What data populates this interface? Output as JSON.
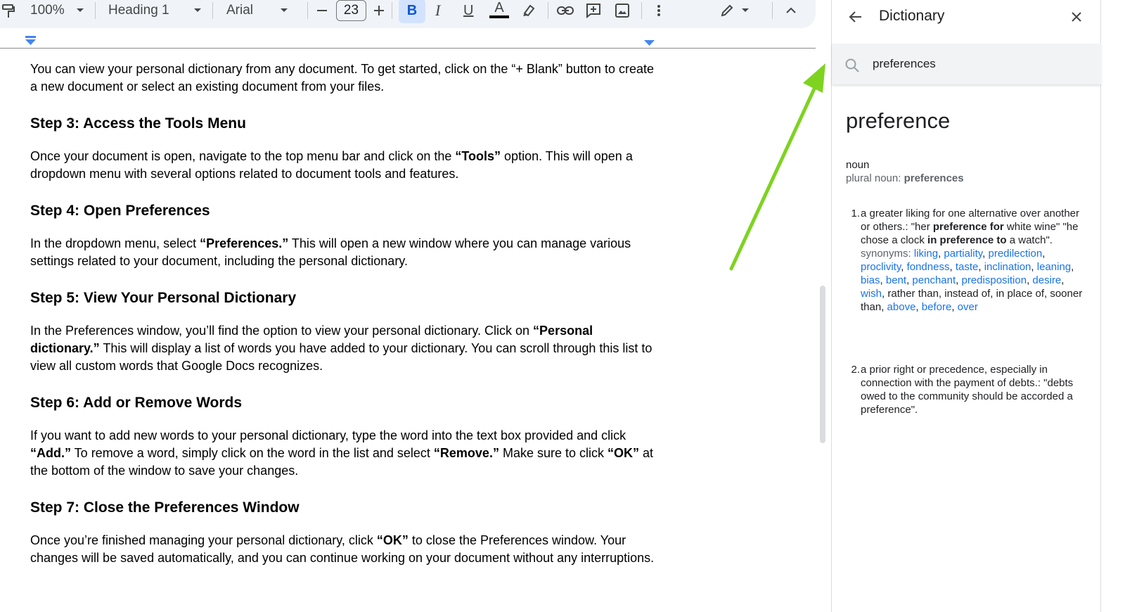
{
  "toolbar": {
    "zoom": "100%",
    "style": "Heading 1",
    "font": "Arial",
    "font_size": "23",
    "bold_label": "B",
    "italic_label": "I",
    "underline_label": "U",
    "text_color_label": "A"
  },
  "document": {
    "intro": "You can view your personal dictionary from any document. To get started, click on the “+ Blank” button to create a new document or select an existing document from your files.",
    "step3_heading": "Step 3: Access the Tools Menu",
    "step3_pre": "Once your document is open, navigate to the top menu bar and click on the ",
    "step3_bold": "“Tools”",
    "step3_post": " option. This will open a dropdown menu with several options related to document tools and features.",
    "step4_heading": "Step 4: Open Preferences",
    "step4_pre": "In the dropdown menu, select ",
    "step4_bold": "“Preferences.”",
    "step4_post": " This will open a new window where you can manage various settings related to your document, including the personal dictionary.",
    "step5_heading": "Step 5: View Your Personal Dictionary",
    "step5_pre": "In the Preferences window, you’ll find the option to view your personal dictionary. Click on ",
    "step5_bold": "“Personal dictionary.”",
    "step5_post": " This will display a list of words you have added to your dictionary. You can scroll through this list to view all custom words that Google Docs recognizes.",
    "step6_heading": "Step 6: Add or Remove Words",
    "step6_a": "If you want to add new words to your personal dictionary, type the word into the text box provided and click ",
    "step6_b": "“Add.”",
    "step6_c": " To remove a word, simply click on the word in the list and select ",
    "step6_d": "“Remove.”",
    "step6_e": " Make sure to click ",
    "step6_f": "“OK”",
    "step6_g": " at the bottom of the window to save your changes.",
    "step7_heading": "Step 7: Close the Preferences Window",
    "step7_pre": "Once you’re finished managing your personal dictionary, click ",
    "step7_bold": "“OK”",
    "step7_post": " to close the Preferences window. Your changes will be saved automatically, and you can continue working on your document without any interruptions."
  },
  "dictionary": {
    "title": "Dictionary",
    "search_value": "preferences",
    "word": "preference",
    "part_of_speech": "noun",
    "plural_label": "plural noun: ",
    "plural_value": "preferences",
    "def1_num": "1.",
    "def1_a": "a greater liking for one alternative over another or others.: \"her ",
    "def1_b": "preference for",
    "def1_c": " white wine\" \"he chose a clock ",
    "def1_d": "in preference to",
    "def1_e": " a watch\".",
    "synonyms_label": "synonyms: ",
    "synonyms": [
      "liking",
      "partiality",
      "predilection",
      "proclivity",
      "fondness",
      "taste",
      "inclination",
      "leaning",
      "bias",
      "bent",
      "penchant",
      "predisposition",
      "desire",
      "wish"
    ],
    "plain_synonyms": "rather than, instead of, in place of, sooner than,",
    "synonyms_tail": [
      "above",
      "before",
      "over"
    ],
    "def2_num": "2.",
    "def2": "a prior right or precedence, especially in connection with the payment of debts.: \"debts owed to the community should be accorded a preference\"."
  },
  "colors": {
    "accent": "#1a73e8",
    "toolbar_bg": "#f0f4f9",
    "bold_active": "#d3e3fd",
    "arrow": "#7ed321"
  }
}
